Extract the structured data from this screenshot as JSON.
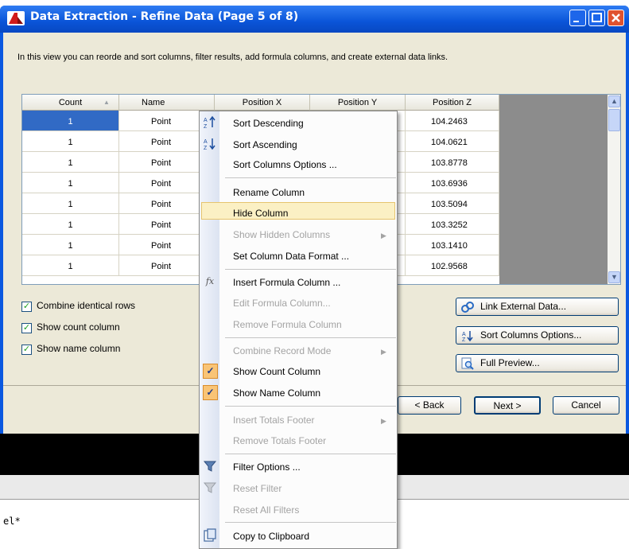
{
  "window": {
    "title": "Data Extraction - Refine Data (Page 5 of 8)",
    "description": "In this view you can reorde and sort columns, filter results, add formula columns, and create external data links."
  },
  "grid": {
    "columns": [
      "Count",
      "Name",
      "Position X",
      "Position Y",
      "Position Z"
    ],
    "count_sort_indicator": "▲",
    "rows": [
      {
        "count": "1",
        "name": "Point",
        "z": "104.2463"
      },
      {
        "count": "1",
        "name": "Point",
        "z": "104.0621"
      },
      {
        "count": "1",
        "name": "Point",
        "z": "103.8778"
      },
      {
        "count": "1",
        "name": "Point",
        "z": "103.6936"
      },
      {
        "count": "1",
        "name": "Point",
        "z": "103.5094"
      },
      {
        "count": "1",
        "name": "Point",
        "z": "103.3252"
      },
      {
        "count": "1",
        "name": "Point",
        "z": "103.1410"
      },
      {
        "count": "1",
        "name": "Point",
        "z": "102.9568"
      }
    ]
  },
  "options": {
    "combine_identical_rows": "Combine identical rows",
    "show_count_column": "Show count column",
    "show_name_column": "Show name column",
    "check_glyph": "✓"
  },
  "buttons": {
    "link_external": "Link External Data...",
    "sort_options": "Sort Columns Options...",
    "full_preview": "Full Preview...",
    "back": "< Back",
    "next": "Next >",
    "cancel": "Cancel"
  },
  "context_menu": {
    "sort_descending": "Sort Descending",
    "sort_ascending": "Sort Ascending",
    "sort_columns_options": "Sort Columns Options ...",
    "rename_column": "Rename Column",
    "hide_column": "Hide Column",
    "show_hidden_columns": "Show Hidden Columns",
    "set_column_data_format": "Set Column Data Format ...",
    "insert_formula_column": "Insert Formula Column ...",
    "edit_formula_column": "Edit Formula Column...",
    "remove_formula_column": "Remove Formula Column",
    "combine_record_mode": "Combine Record Mode",
    "show_count_column": "Show Count Column",
    "show_name_column": "Show Name Column",
    "insert_totals_footer": "Insert Totals Footer",
    "remove_totals_footer": "Remove Totals Footer",
    "filter_options": "Filter Options ...",
    "reset_filter": "Reset Filter",
    "reset_all_filters": "Reset All Filters",
    "copy_to_clipboard": "Copy to Clipboard",
    "submenu_arrow": "▶",
    "fx_glyph": "fx",
    "check_glyph": "✓"
  },
  "command_line": {
    "text": "el*"
  },
  "colors": {
    "title_bar": "#0a54d8",
    "highlight": "#fbf0c4",
    "dialog_bg": "#ece9d8"
  }
}
